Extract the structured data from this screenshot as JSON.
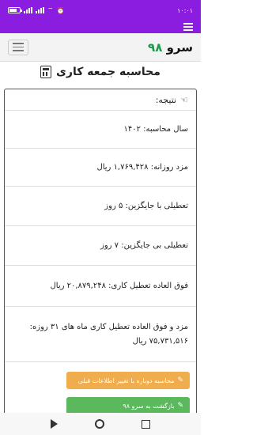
{
  "status_bar": {
    "time": "۱۰:۰۱",
    "battery_level": 0.75
  },
  "navbar": {
    "brand_text": "سرو ",
    "brand_num": "۹۸"
  },
  "page": {
    "title": "محاسبه جمعه کاری"
  },
  "result": {
    "header": "نتیجه:",
    "rows": [
      "سال محاسبه: ۱۴۰۲",
      "مزد روزانه: ۱,۷۶۹,۴۲۸ ریال",
      "تعطیلی با جایگزین: ۵ روز",
      "تعطیلی بی جایگزین: ۷ روز",
      "فوق العاده تعطیل کاری: ۲۰,۸۷۹,۲۴۸ ریال",
      "مزد و فوق العاده تعطیل کاری ماه های ۳۱ روزه: ۷۵,۷۳۱,۵۱۶ ریال"
    ]
  },
  "buttons": {
    "recalc": "محاسبه دوباره با تغییر اطلاعات قبلی",
    "back": "بازگشت به سرو ۹۸"
  },
  "colors": {
    "primary": "#8a1de0",
    "orange": "#f0ad4e",
    "green": "#5cb85c",
    "brand_num": "#1a9a4b"
  }
}
